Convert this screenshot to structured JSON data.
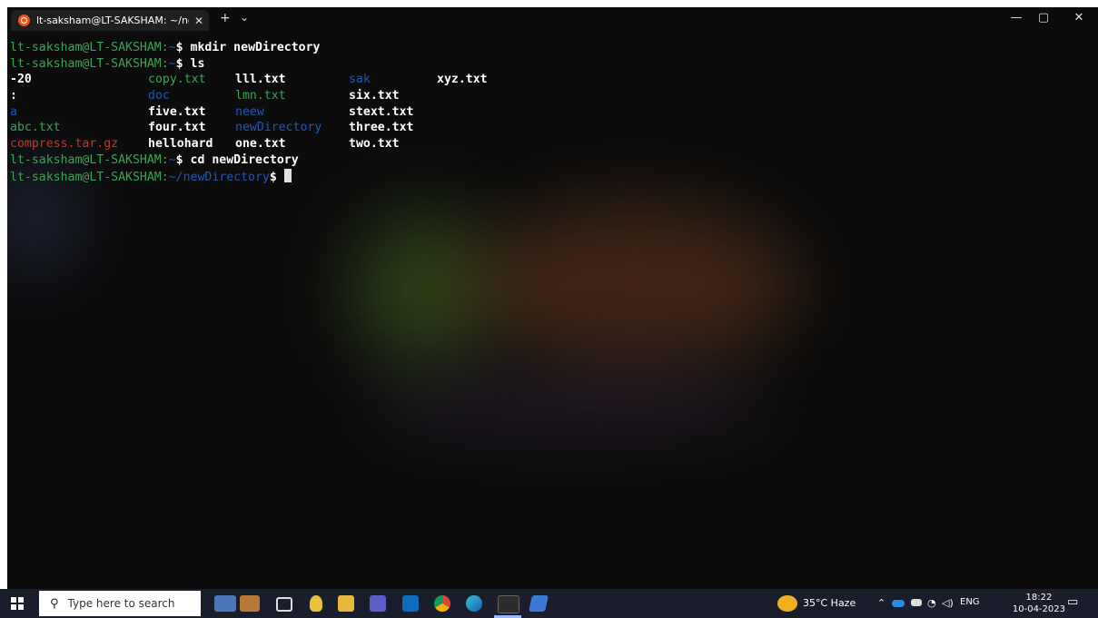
{
  "window": {
    "tab_title": "lt-saksham@LT-SAKSHAM: ~/newDirectory",
    "tab_close": "✕",
    "new_tab": "+",
    "dropdown": "⌄",
    "minimize": "—",
    "maximize": "▢",
    "close": "✕"
  },
  "terminal": {
    "prompt_user": "lt-saksham@LT-SAKSHAM",
    "colon": ":",
    "home": "~",
    "path_newdir": "~/newDirectory",
    "dollar": "$",
    "commands": [
      "mkdir newDirectory",
      "ls",
      "cd newDirectory"
    ],
    "ls_output": [
      [
        "-20",
        "copy.txt",
        "lll.txt",
        "sak",
        "xyz.txt"
      ],
      [
        ":",
        "doc",
        "lmn.txt",
        "six.txt",
        ""
      ],
      [
        "a",
        "five.txt",
        "neew",
        "stext.txt",
        ""
      ],
      [
        "abc.txt",
        "four.txt",
        "newDirectory",
        "three.txt",
        ""
      ],
      [
        "compress.tar.gz",
        "hellohard",
        "one.txt",
        "two.txt",
        ""
      ]
    ],
    "colors": {
      "prompt": "#3ea357",
      "directory": "#1f57b6",
      "archive": "#c0392b",
      "text": "#ffffff"
    }
  },
  "taskbar": {
    "search_placeholder": "Type here to search",
    "weather": "35°C  Haze",
    "language": "ENG",
    "time": "18:22",
    "date": "10-04-2023",
    "icons": [
      "windows-start-icon",
      "search-icon",
      "file-explorer-icon",
      "briefcase-icon",
      "task-view-icon",
      "linux-tux-icon",
      "folder-icon",
      "teams-icon",
      "outlook-icon",
      "chrome-icon",
      "edge-icon",
      "terminal-icon",
      "app-icon",
      "weather-icon",
      "chevron-up-icon",
      "onedrive-icon",
      "battery-icon",
      "wifi-icon",
      "volume-icon",
      "notification-icon"
    ]
  }
}
